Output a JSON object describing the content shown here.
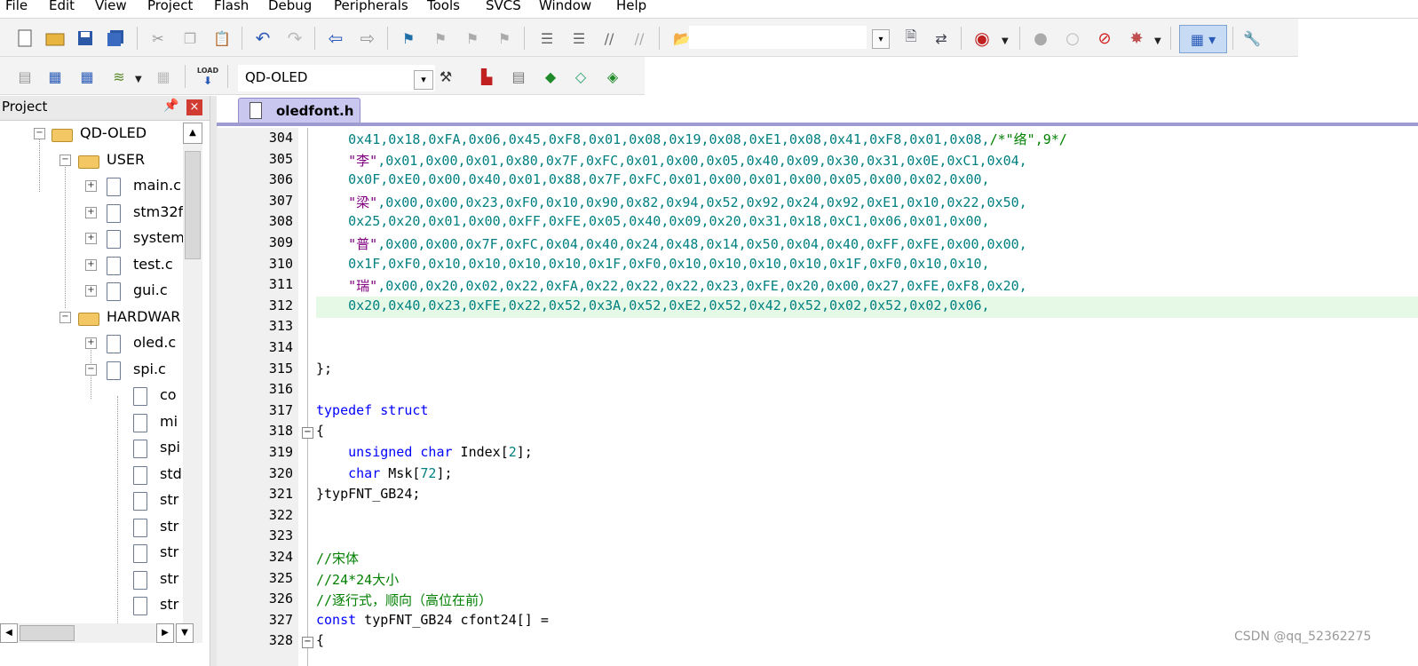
{
  "menu": [
    "File",
    "Edit",
    "View",
    "Project",
    "Flash",
    "Debug",
    "Peripherals",
    "Tools",
    "SVCS",
    "Window",
    "Help"
  ],
  "toolbar": {
    "target_name": "QD-OLED",
    "load_label": "LOAD"
  },
  "panel": {
    "title": "Project",
    "close": "×"
  },
  "tree": [
    {
      "label": "QD-OLED",
      "kind": "root"
    },
    {
      "label": "USER",
      "kind": "folder"
    },
    {
      "label": "main.c",
      "kind": "file"
    },
    {
      "label": "stm32f",
      "kind": "file"
    },
    {
      "label": "system",
      "kind": "file"
    },
    {
      "label": "test.c",
      "kind": "file"
    },
    {
      "label": "gui.c",
      "kind": "file"
    },
    {
      "label": "HARDWAR",
      "kind": "folder"
    },
    {
      "label": "oled.c",
      "kind": "file"
    },
    {
      "label": "spi.c",
      "kind": "file"
    },
    {
      "label": "co",
      "kind": "leaf"
    },
    {
      "label": "mi",
      "kind": "leaf"
    },
    {
      "label": "spi",
      "kind": "leaf"
    },
    {
      "label": "std",
      "kind": "leaf"
    },
    {
      "label": "str",
      "kind": "leaf"
    },
    {
      "label": "str",
      "kind": "leaf"
    },
    {
      "label": "str",
      "kind": "leaf"
    },
    {
      "label": "str",
      "kind": "leaf"
    },
    {
      "label": "str",
      "kind": "leaf"
    }
  ],
  "tab": {
    "active_file": "oledfont.h"
  },
  "code": [
    {
      "n": "304",
      "segs": [
        [
          "    0x41,0x18,0xFA,0x06,0x45,0xF8,0x01,0x08,0x19,0x08,0xE1,0x08,0x41,0xF8,0x01,0x08,",
          "hex"
        ],
        [
          "/*\"络\",9*/",
          "cmt"
        ]
      ]
    },
    {
      "n": "305",
      "segs": [
        [
          "    ",
          "txt"
        ],
        [
          "\"李\"",
          "str"
        ],
        [
          ",0x01,0x00,0x01,0x80,0x7F,0xFC,0x01,0x00,0x05,0x40,0x09,0x30,0x31,0x0E,0xC1,0x04,",
          "hex"
        ]
      ]
    },
    {
      "n": "306",
      "segs": [
        [
          "    0x0F,0xE0,0x00,0x40,0x01,0x88,0x7F,0xFC,0x01,0x00,0x01,0x00,0x05,0x00,0x02,0x00,",
          "hex"
        ]
      ]
    },
    {
      "n": "307",
      "segs": [
        [
          "    ",
          "txt"
        ],
        [
          "\"梁\"",
          "str"
        ],
        [
          ",0x00,0x00,0x23,0xF0,0x10,0x90,0x82,0x94,0x52,0x92,0x24,0x92,0xE1,0x10,0x22,0x50,",
          "hex"
        ]
      ]
    },
    {
      "n": "308",
      "segs": [
        [
          "    0x25,0x20,0x01,0x00,0xFF,0xFE,0x05,0x40,0x09,0x20,0x31,0x18,0xC1,0x06,0x01,0x00,",
          "hex"
        ]
      ]
    },
    {
      "n": "309",
      "segs": [
        [
          "    ",
          "txt"
        ],
        [
          "\"普\"",
          "str"
        ],
        [
          ",0x00,0x00,0x7F,0xFC,0x04,0x40,0x24,0x48,0x14,0x50,0x04,0x40,0xFF,0xFE,0x00,0x00,",
          "hex"
        ]
      ]
    },
    {
      "n": "310",
      "segs": [
        [
          "    0x1F,0xF0,0x10,0x10,0x10,0x10,0x1F,0xF0,0x10,0x10,0x10,0x10,0x1F,0xF0,0x10,0x10,",
          "hex"
        ]
      ]
    },
    {
      "n": "311",
      "segs": [
        [
          "    ",
          "txt"
        ],
        [
          "\"瑞\"",
          "str"
        ],
        [
          ",0x00,0x20,0x02,0x22,0xFA,0x22,0x22,0x22,0x23,0xFE,0x20,0x00,0x27,0xFE,0xF8,0x20,",
          "hex"
        ]
      ]
    },
    {
      "n": "312",
      "segs": [
        [
          "    0x20,0x40,0x23,0xFE,0x22,0x52,0x3A,0x52,0xE2,0x52,0x42,0x52,0x02,0x52,0x02,0x06,",
          "hex"
        ]
      ]
    },
    {
      "n": "313",
      "segs": []
    },
    {
      "n": "314",
      "segs": []
    },
    {
      "n": "315",
      "segs": [
        [
          "};",
          "txt"
        ]
      ]
    },
    {
      "n": "316",
      "segs": []
    },
    {
      "n": "317",
      "segs": [
        [
          "typedef struct",
          "kw"
        ]
      ]
    },
    {
      "n": "318",
      "segs": [
        [
          "{",
          "txt"
        ]
      ]
    },
    {
      "n": "319",
      "segs": [
        [
          "    ",
          "txt"
        ],
        [
          "unsigned char",
          "kw"
        ],
        [
          " Index[",
          "txt"
        ],
        [
          "2",
          "num"
        ],
        [
          "];",
          "txt"
        ]
      ]
    },
    {
      "n": "320",
      "segs": [
        [
          "    ",
          "txt"
        ],
        [
          "char",
          "kw"
        ],
        [
          " Msk[",
          "txt"
        ],
        [
          "72",
          "num"
        ],
        [
          "];",
          "txt"
        ]
      ]
    },
    {
      "n": "321",
      "segs": [
        [
          "}typFNT_GB24;",
          "txt"
        ]
      ]
    },
    {
      "n": "322",
      "segs": []
    },
    {
      "n": "323",
      "segs": []
    },
    {
      "n": "324",
      "segs": [
        [
          "//宋体",
          "cmt"
        ]
      ]
    },
    {
      "n": "325",
      "segs": [
        [
          "//24*24大小",
          "cmt"
        ]
      ]
    },
    {
      "n": "326",
      "segs": [
        [
          "//逐行式，顺向（高位在前）",
          "cmt"
        ]
      ]
    },
    {
      "n": "327",
      "segs": [
        [
          "const",
          "kw"
        ],
        [
          " typFNT_GB24 cfont24[] =",
          "txt"
        ]
      ]
    },
    {
      "n": "328",
      "segs": [
        [
          "{",
          "txt"
        ]
      ]
    }
  ],
  "watermark": "CSDN @qq_52362275"
}
